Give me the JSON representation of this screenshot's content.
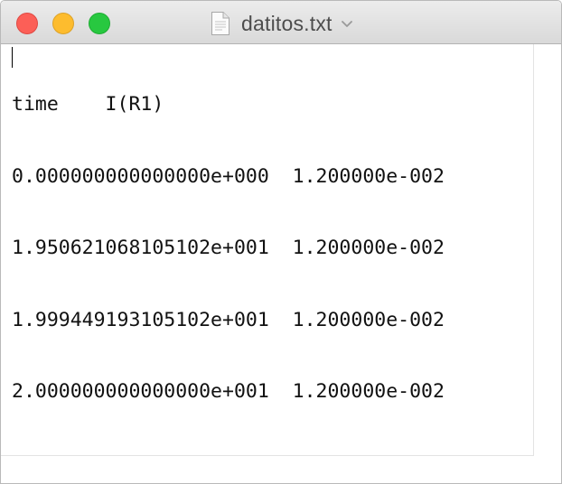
{
  "window": {
    "title": "datitos.txt",
    "file_icon": "document-icon",
    "title_menu_icon": "chevron-down-icon",
    "traffic_lights": {
      "close_color": "#fc5f57",
      "minimize_color": "#fdbc2e",
      "zoom_color": "#28c840"
    }
  },
  "document": {
    "lines": [
      "time    I(R1)",
      "0.000000000000000e+000  1.200000e-002",
      "1.950621068105102e+001  1.200000e-002",
      "1.999449193105102e+001  1.200000e-002",
      "2.000000000000000e+001  1.200000e-002"
    ]
  }
}
